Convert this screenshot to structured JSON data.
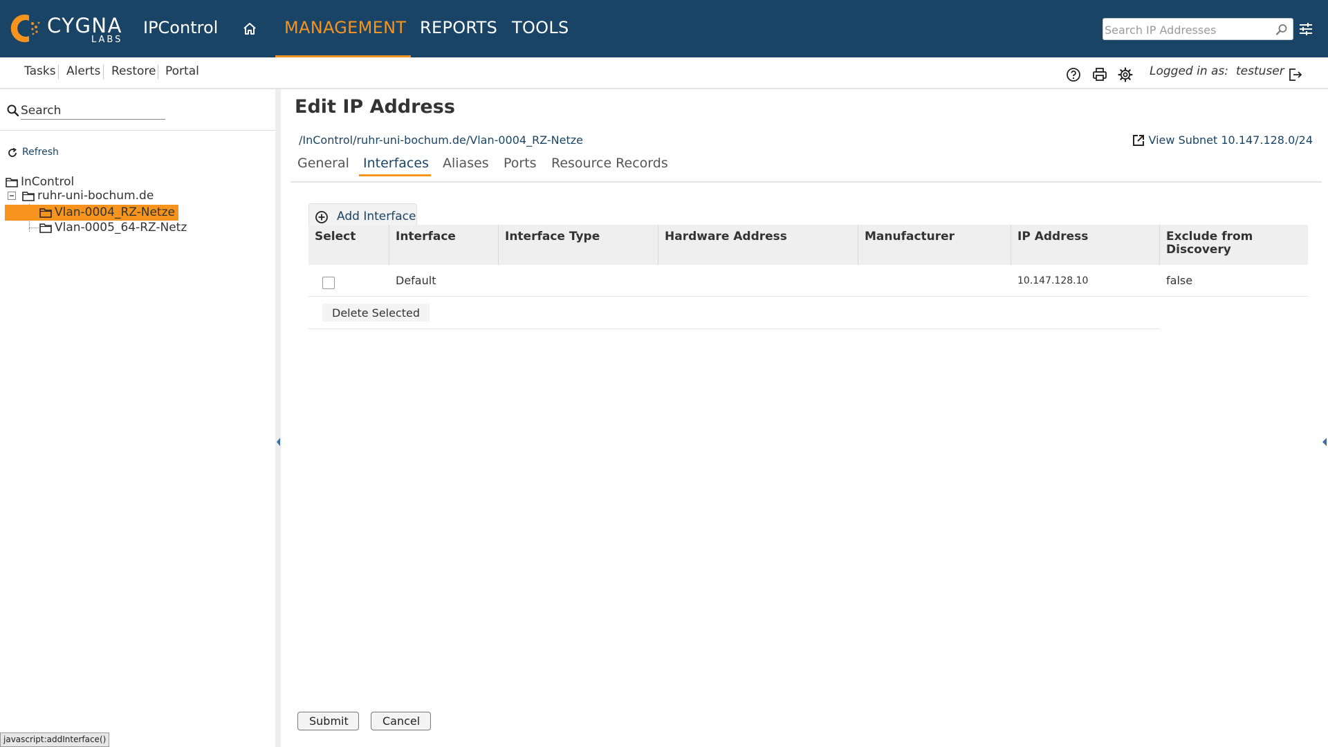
{
  "brand": {
    "name": "CYGNA",
    "sub": "LABS",
    "accent": "#f7941d",
    "header_bg": "#1a4466"
  },
  "app": {
    "title": "IPControl"
  },
  "nav": {
    "home_icon": "home-icon",
    "items": [
      {
        "label": "MANAGEMENT",
        "active": true
      },
      {
        "label": "REPORTS",
        "active": false
      },
      {
        "label": "TOOLS",
        "active": false
      }
    ]
  },
  "search": {
    "placeholder": "Search IP Addresses",
    "value": ""
  },
  "subnav": {
    "links": [
      "Tasks",
      "Alerts",
      "Restore",
      "Portal"
    ],
    "icons": [
      "help-icon",
      "print-icon",
      "gear-icon",
      "logout-icon"
    ],
    "logged_label": "Logged in as:",
    "user": "testuser"
  },
  "sidebar": {
    "search_placeholder": "Search",
    "refresh_label": "Refresh",
    "tree": [
      {
        "label": "InControl",
        "level": 0
      },
      {
        "label": "ruhr-uni-bochum.de",
        "level": 1,
        "expanded": true
      },
      {
        "label": "Vlan-0004_RZ-Netze",
        "level": 2,
        "selected": true
      },
      {
        "label": "Vlan-0005_64-RZ-Netz",
        "level": 2
      }
    ]
  },
  "page": {
    "title": "Edit IP Address",
    "breadcrumb": "/InControl/ruhr-uni-bochum.de/Vlan-0004_RZ-Netze",
    "view_subnet": "View Subnet 10.147.128.0/24",
    "tabs": [
      {
        "label": "General",
        "active": false
      },
      {
        "label": "Interfaces",
        "active": true
      },
      {
        "label": "Aliases",
        "active": false
      },
      {
        "label": "Ports",
        "active": false
      },
      {
        "label": "Resource Records",
        "active": false
      }
    ],
    "add_interface_label": "Add Interface",
    "table": {
      "columns": [
        "Select",
        "Interface",
        "Interface Type",
        "Hardware Address",
        "Manufacturer",
        "IP Address",
        "Exclude from Discovery"
      ],
      "rows": [
        {
          "select": false,
          "interface": "Default",
          "interface_type": "",
          "hardware_address": "",
          "manufacturer": "",
          "ip_address": "10.147.128.10",
          "exclude": "false"
        }
      ]
    },
    "delete_selected_label": "Delete Selected",
    "submit_label": "Submit",
    "cancel_label": "Cancel"
  },
  "status_bar": {
    "text": "javascript:addInterface()"
  }
}
